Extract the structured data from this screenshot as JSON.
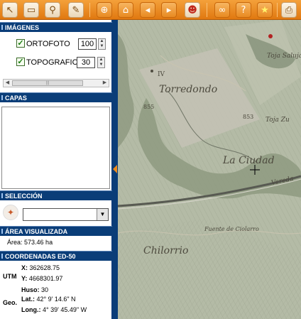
{
  "toolbar": {
    "buttons": [
      {
        "icon": "pan-arrow-icon"
      },
      {
        "icon": "ruler-icon"
      },
      {
        "icon": "magnifier-icon"
      },
      {
        "icon": "scroll-icon"
      },
      {
        "icon": "zoom-in-icon"
      },
      {
        "icon": "home-icon"
      },
      {
        "icon": "previous-view-icon"
      },
      {
        "icon": "next-view-icon"
      },
      {
        "icon": "person-icon"
      },
      {
        "icon": "binoculars-icon"
      },
      {
        "icon": "help-icon"
      },
      {
        "icon": "star-icon"
      },
      {
        "icon": "print-icon"
      }
    ]
  },
  "imagenes": {
    "title": "IMÁGENES",
    "layers": [
      {
        "label": "ORTOFOTO",
        "checked": true,
        "value": "100"
      },
      {
        "label": "TOPOGRAFICO",
        "checked": true,
        "value": "30"
      }
    ]
  },
  "capas": {
    "title": "CAPAS"
  },
  "seleccion": {
    "title": "SELECCIÓN",
    "value": ""
  },
  "area": {
    "title": "ÁREA VISUALIZADA",
    "label": "Área:",
    "value": "573.46 ha"
  },
  "coords": {
    "title": "COORDENADAS ED-50",
    "utm_label": "UTM",
    "x_label": "X:",
    "x": "362628.75",
    "y_label": "Y:",
    "y": "4668301.97",
    "geo_label": "Geo.",
    "huso_label": "Huso:",
    "huso": "30",
    "lat_label": "Lat.:",
    "lat": "42° 9' 14.6\" N",
    "long_label": "Long.:",
    "long": "4° 39' 45.49\" W"
  },
  "map": {
    "places": [
      {
        "text": "Torredondo"
      },
      {
        "text": "La Ciudad"
      },
      {
        "text": "Chilorrio"
      },
      {
        "text": "Toja Saluja"
      },
      {
        "text": "Toja Zu"
      },
      {
        "text": "Fuente de Ciolarro"
      },
      {
        "text": "Vereda"
      },
      {
        "text": "IV"
      },
      {
        "text": "855"
      },
      {
        "text": "853"
      }
    ]
  },
  "colors": {
    "header": "#0a3d78",
    "toolbar": "#f08a1a"
  }
}
